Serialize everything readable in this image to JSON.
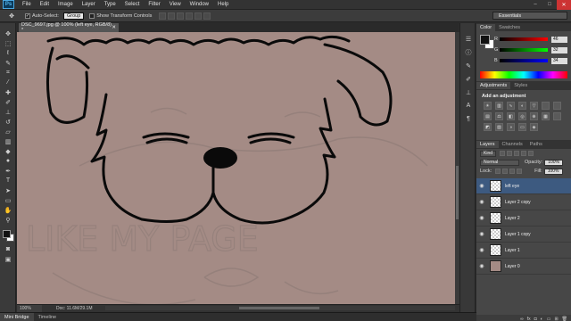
{
  "menubar": {
    "logo": "Ps",
    "items": [
      "File",
      "Edit",
      "Image",
      "Layer",
      "Type",
      "Select",
      "Filter",
      "View",
      "Window",
      "Help"
    ],
    "window_controls": [
      "–",
      "□",
      "✕"
    ]
  },
  "options": {
    "auto_select_label": "Auto-Select:",
    "auto_select_value": "Group",
    "show_transform_label": "Show Transform Controls",
    "workspace": "Essentials"
  },
  "document": {
    "tab_title": "DSC_9697.jpg @ 100% (left eye, RGB/8) *",
    "tab_close": "✕",
    "canvas_faint_text": "LIKE MY PAGE"
  },
  "status": {
    "zoom": "100%",
    "doc_size": "Doc: 11.6M/29.1M"
  },
  "bottom_tabs": [
    "Mini Bridge",
    "Timeline"
  ],
  "color_panel": {
    "tabs": [
      "Color",
      "Swatches"
    ],
    "channels": [
      {
        "label": "R",
        "value": "46",
        "color": "#e04040"
      },
      {
        "label": "G",
        "value": "32",
        "color": "#40c040"
      },
      {
        "label": "B",
        "value": "34",
        "color": "#4060e0"
      }
    ]
  },
  "adjustments_panel": {
    "tabs": [
      "Adjustments",
      "Styles"
    ],
    "title": "Add an adjustment"
  },
  "layers_panel": {
    "tabs": [
      "Layers",
      "Channels",
      "Paths"
    ],
    "filter_kind": "Kind",
    "blend_mode": "Normal",
    "opacity_label": "Opacity:",
    "opacity_value": "100%",
    "lock_label": "Lock:",
    "fill_label": "Fill:",
    "fill_value": "100%",
    "layers": [
      {
        "name": "left eye",
        "selected": true,
        "photo": false
      },
      {
        "name": "Layer 2 copy",
        "selected": false,
        "photo": false
      },
      {
        "name": "Layer 2",
        "selected": false,
        "photo": false
      },
      {
        "name": "Layer 1 copy",
        "selected": false,
        "photo": false
      },
      {
        "name": "Layer 1",
        "selected": false,
        "photo": false
      },
      {
        "name": "Layer 0",
        "selected": false,
        "photo": true
      }
    ]
  }
}
